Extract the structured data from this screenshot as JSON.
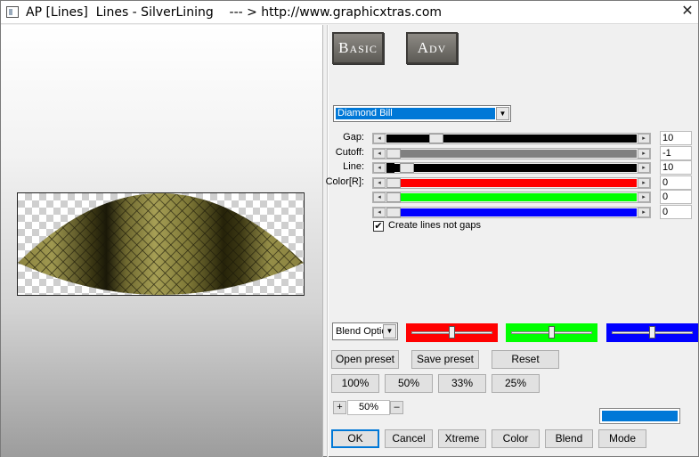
{
  "window": {
    "title": "AP [Lines]  Lines - SilverLining    --- > http://www.graphicxtras.com",
    "close_glyph": "✕"
  },
  "modes": {
    "basic_label": "Basic",
    "adv_label": "Adv"
  },
  "preset_select": {
    "value": "Diamond Bill",
    "arrow": "▼"
  },
  "sliders": [
    {
      "label": "Gap:",
      "value": "10",
      "fill": "#000000",
      "thumb": 0.18
    },
    {
      "label": "Cutoff:",
      "value": "-1",
      "fill": "#808080",
      "thumb": 0.0
    },
    {
      "label": "Line:",
      "value": "10",
      "fill": "#000000",
      "thumb": 0.055,
      "pre_thumb": true
    },
    {
      "label": "Color[R]:",
      "value": "0",
      "fill": "#ff0000",
      "thumb": 0.0
    },
    {
      "label": "",
      "value": "0",
      "fill": "#00ff00",
      "thumb": 0.0
    },
    {
      "label": "",
      "value": "0",
      "fill": "#0000ff",
      "thumb": 0.0
    }
  ],
  "arrows": {
    "left": "◂",
    "right": "▸"
  },
  "checkbox": {
    "label": "Create lines not gaps",
    "checked": true,
    "mark": "✔"
  },
  "blend": {
    "value": "Blend Optio",
    "arrow": "▼"
  },
  "color_sliders": [
    {
      "color": "#ff0000",
      "level": 0.5
    },
    {
      "color": "#00ff00",
      "level": 0.5
    },
    {
      "color": "#0000ff",
      "level": 0.5
    }
  ],
  "preset_buttons": {
    "open": "Open preset",
    "save": "Save preset",
    "reset": "Reset"
  },
  "zoom_buttons": [
    "100%",
    "50%",
    "33%",
    "25%"
  ],
  "zoom_stepper": {
    "plus": "+",
    "value": "50%",
    "minus": "–"
  },
  "accent_color": "#0078d7",
  "bottom_buttons": {
    "ok": "OK",
    "cancel": "Cancel",
    "xtreme": "Xtreme",
    "color": "Color",
    "blend": "Blend",
    "mode": "Mode"
  }
}
